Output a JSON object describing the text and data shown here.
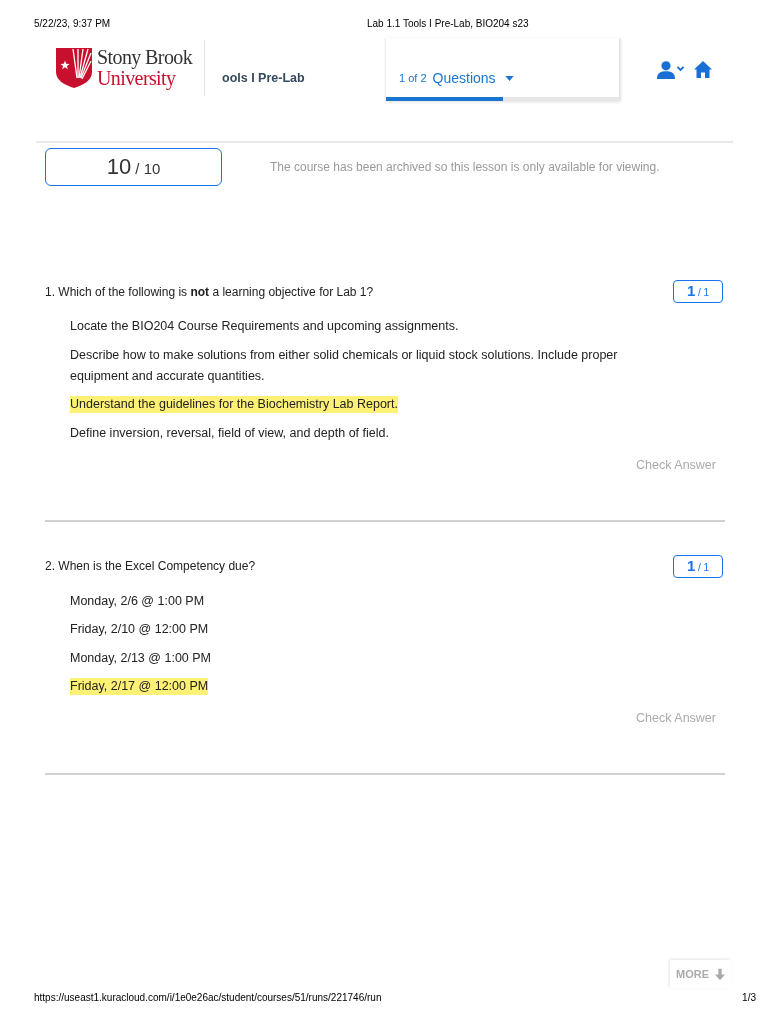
{
  "print_header": {
    "date": "5/22/23, 9:37 PM",
    "title": "Lab 1.1 Tools I Pre-Lab, BIO204 s23"
  },
  "header": {
    "logo": {
      "line_1": "Stony Brook",
      "line_2": "University"
    },
    "breadcrumb": "ools I Pre-Lab",
    "questions_menu": {
      "position": "1 of 2",
      "label": "Questions",
      "level": 0.5
    }
  },
  "score": {
    "value": "10",
    "max": "/ 10"
  },
  "notice": "The course has been archived so this lesson is only available for viewing.",
  "questions": [
    {
      "prompt": "1. Which of the following is **not** a learning objective for Lab 1?",
      "score": {
        "value": "1",
        "max": "/ 1"
      },
      "options": [
        {
          "text": "Locate the BIO204 Course Requirements and upcoming assignments.",
          "selected": false
        },
        {
          "text": "Describe how to make solutions from either solid chemicals or liquid stock solutions. Include proper equipment and accurate quantities.",
          "selected": false
        },
        {
          "text": "Understand the guidelines for the Biochemistry Lab Report.",
          "selected": true
        },
        {
          "text": "Define inversion, reversal, field of view, and depth of field.",
          "selected": false
        }
      ],
      "check_button": {
        "label": "Check Answer",
        "disabled": true
      }
    },
    {
      "prompt": "2. When is the Excel Competency due?",
      "score": {
        "value": "1",
        "max": "/ 1"
      },
      "options": [
        {
          "text": "Monday, 2/6 @ 1:00 PM",
          "selected": false
        },
        {
          "text": "Friday, 2/10 @ 12:00 PM",
          "selected": false
        },
        {
          "text": "Monday, 2/13 @ 1:00 PM",
          "selected": false
        },
        {
          "text": "Friday, 2/17 @ 12:00 PM",
          "selected": true
        }
      ],
      "check_button": {
        "label": "Check Answer",
        "disabled": true
      }
    }
  ],
  "more_button": {
    "label": "MORE"
  },
  "print_footer": {
    "url": "https://useast1.kuracloud.com/i/1e0e26ac/student/courses/51/runs/221746/run",
    "page": "1/3"
  }
}
